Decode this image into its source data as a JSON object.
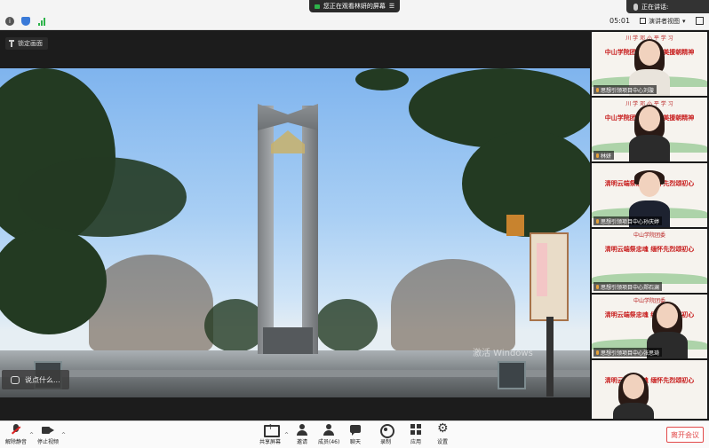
{
  "top": {
    "screen_banner": "您正在观看林妍的屏幕",
    "speaking": "正在讲话:",
    "timer": "05:01",
    "view_label": "演讲者视图"
  },
  "stage": {
    "pin_label": "锁定画面",
    "watermark": "激活 Windows",
    "chat_prompt": "说点什么..."
  },
  "gallery": {
    "tiles": [
      {
        "banner": "川 学 邓 小 平 学 习",
        "slogan": "中山学院团委 传承抗美援朝精神",
        "name": "思想引领项目中心刘璇"
      },
      {
        "banner": "川 学 邓 小 平 学 习",
        "slogan": "中山学院团委 传承抗美援朝精神",
        "name": "林妍"
      },
      {
        "banner": "",
        "slogan": "清明云端祭忠魂 缅怀先烈颂初心",
        "name": "思想引领项目中心孙庆婷"
      },
      {
        "banner": "中山学院团委",
        "slogan": "清明云端祭忠魂 缅怀先烈颂初心",
        "name": "思想引领项目中心郑石澜"
      },
      {
        "banner": "中山学院团委",
        "slogan": "清明云端祭忠魂 缅怀先烈颂初心",
        "name": "思想引领项目中心张思琦"
      },
      {
        "banner": "",
        "slogan": "清明云端祭忠魂 缅怀先烈颂初心",
        "name": ""
      }
    ]
  },
  "toolbar": {
    "unmute": "解除静音",
    "stop_video": "停止视频",
    "share": "共享屏幕",
    "invite": "邀请",
    "members": "成员(46)",
    "chat": "聊天",
    "record": "录制",
    "apps": "应用",
    "settings": "设置",
    "leave": "离开会议"
  },
  "colors": {
    "leave": "#e24a4a",
    "stage_bg": "#1c1c1c",
    "slogan_red": "#c71a1a"
  }
}
